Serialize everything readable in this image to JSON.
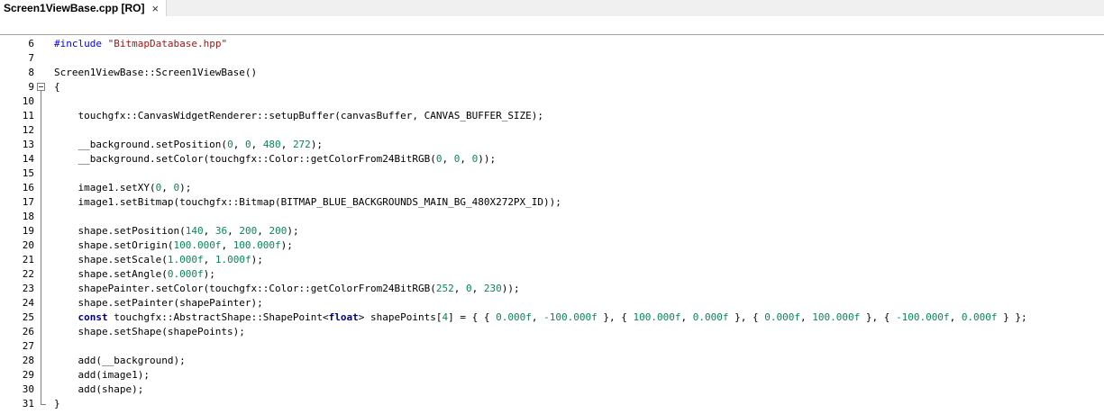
{
  "tab": {
    "label": "Screen1ViewBase.cpp [RO]",
    "close_glyph": "×"
  },
  "editor": {
    "lines": [
      {
        "num": "6",
        "tokens": [
          {
            "t": "#include ",
            "c": "pp"
          },
          {
            "t": "\"BitmapDatabase.hpp\"",
            "c": "str"
          }
        ]
      },
      {
        "num": "7",
        "tokens": []
      },
      {
        "num": "8",
        "tokens": [
          {
            "t": "Screen1ViewBase::Screen1ViewBase()",
            "c": "tok"
          }
        ]
      },
      {
        "num": "9",
        "tokens": [
          {
            "t": "{",
            "c": "tok"
          }
        ]
      },
      {
        "num": "10",
        "tokens": []
      },
      {
        "num": "11",
        "tokens": [
          {
            "t": "    touchgfx::CanvasWidgetRenderer::setupBuffer(canvasBuffer, CANVAS_BUFFER_SIZE);",
            "c": "tok"
          }
        ]
      },
      {
        "num": "12",
        "tokens": []
      },
      {
        "num": "13",
        "tokens": [
          {
            "t": "    __background.setPosition(",
            "c": "tok"
          },
          {
            "t": "0",
            "c": "num"
          },
          {
            "t": ", ",
            "c": "tok"
          },
          {
            "t": "0",
            "c": "num"
          },
          {
            "t": ", ",
            "c": "tok"
          },
          {
            "t": "480",
            "c": "num"
          },
          {
            "t": ", ",
            "c": "tok"
          },
          {
            "t": "272",
            "c": "num"
          },
          {
            "t": ");",
            "c": "tok"
          }
        ]
      },
      {
        "num": "14",
        "tokens": [
          {
            "t": "    __background.setColor(touchgfx::Color::getColorFrom24BitRGB(",
            "c": "tok"
          },
          {
            "t": "0",
            "c": "num"
          },
          {
            "t": ", ",
            "c": "tok"
          },
          {
            "t": "0",
            "c": "num"
          },
          {
            "t": ", ",
            "c": "tok"
          },
          {
            "t": "0",
            "c": "num"
          },
          {
            "t": "));",
            "c": "tok"
          }
        ]
      },
      {
        "num": "15",
        "tokens": []
      },
      {
        "num": "16",
        "tokens": [
          {
            "t": "    image1.setXY(",
            "c": "tok"
          },
          {
            "t": "0",
            "c": "num"
          },
          {
            "t": ", ",
            "c": "tok"
          },
          {
            "t": "0",
            "c": "num"
          },
          {
            "t": ");",
            "c": "tok"
          }
        ]
      },
      {
        "num": "17",
        "tokens": [
          {
            "t": "    image1.setBitmap(touchgfx::Bitmap(BITMAP_BLUE_BACKGROUNDS_MAIN_BG_480X272PX_ID));",
            "c": "tok"
          }
        ]
      },
      {
        "num": "18",
        "tokens": []
      },
      {
        "num": "19",
        "tokens": [
          {
            "t": "    shape.setPosition(",
            "c": "tok"
          },
          {
            "t": "140",
            "c": "num"
          },
          {
            "t": ", ",
            "c": "tok"
          },
          {
            "t": "36",
            "c": "num"
          },
          {
            "t": ", ",
            "c": "tok"
          },
          {
            "t": "200",
            "c": "num"
          },
          {
            "t": ", ",
            "c": "tok"
          },
          {
            "t": "200",
            "c": "num"
          },
          {
            "t": ");",
            "c": "tok"
          }
        ]
      },
      {
        "num": "20",
        "tokens": [
          {
            "t": "    shape.setOrigin(",
            "c": "tok"
          },
          {
            "t": "100.000f",
            "c": "num"
          },
          {
            "t": ", ",
            "c": "tok"
          },
          {
            "t": "100.000f",
            "c": "num"
          },
          {
            "t": ");",
            "c": "tok"
          }
        ]
      },
      {
        "num": "21",
        "tokens": [
          {
            "t": "    shape.setScale(",
            "c": "tok"
          },
          {
            "t": "1.000f",
            "c": "num"
          },
          {
            "t": ", ",
            "c": "tok"
          },
          {
            "t": "1.000f",
            "c": "num"
          },
          {
            "t": ");",
            "c": "tok"
          }
        ]
      },
      {
        "num": "22",
        "tokens": [
          {
            "t": "    shape.setAngle(",
            "c": "tok"
          },
          {
            "t": "0.000f",
            "c": "num"
          },
          {
            "t": ");",
            "c": "tok"
          }
        ]
      },
      {
        "num": "23",
        "tokens": [
          {
            "t": "    shapePainter.setColor(touchgfx::Color::getColorFrom24BitRGB(",
            "c": "tok"
          },
          {
            "t": "252",
            "c": "num"
          },
          {
            "t": ", ",
            "c": "tok"
          },
          {
            "t": "0",
            "c": "num"
          },
          {
            "t": ", ",
            "c": "tok"
          },
          {
            "t": "230",
            "c": "num"
          },
          {
            "t": "));",
            "c": "tok"
          }
        ]
      },
      {
        "num": "24",
        "tokens": [
          {
            "t": "    shape.setPainter(shapePainter);",
            "c": "tok"
          }
        ]
      },
      {
        "num": "25",
        "tokens": [
          {
            "t": "    ",
            "c": "tok"
          },
          {
            "t": "const",
            "c": "bold"
          },
          {
            "t": " touchgfx::AbstractShape::ShapePoint<",
            "c": "tok"
          },
          {
            "t": "float",
            "c": "bold"
          },
          {
            "t": "> shapePoints[",
            "c": "tok"
          },
          {
            "t": "4",
            "c": "num"
          },
          {
            "t": "] = { { ",
            "c": "tok"
          },
          {
            "t": "0.000f",
            "c": "num"
          },
          {
            "t": ", ",
            "c": "tok"
          },
          {
            "t": "-100.000f",
            "c": "num"
          },
          {
            "t": " }, { ",
            "c": "tok"
          },
          {
            "t": "100.000f",
            "c": "num"
          },
          {
            "t": ", ",
            "c": "tok"
          },
          {
            "t": "0.000f",
            "c": "num"
          },
          {
            "t": " }, { ",
            "c": "tok"
          },
          {
            "t": "0.000f",
            "c": "num"
          },
          {
            "t": ", ",
            "c": "tok"
          },
          {
            "t": "100.000f",
            "c": "num"
          },
          {
            "t": " }, { ",
            "c": "tok"
          },
          {
            "t": "-100.000f",
            "c": "num"
          },
          {
            "t": ", ",
            "c": "tok"
          },
          {
            "t": "0.000f",
            "c": "num"
          },
          {
            "t": " } };",
            "c": "tok"
          }
        ]
      },
      {
        "num": "26",
        "tokens": [
          {
            "t": "    shape.setShape(shapePoints);",
            "c": "tok"
          }
        ]
      },
      {
        "num": "27",
        "tokens": []
      },
      {
        "num": "28",
        "tokens": [
          {
            "t": "    add(__background);",
            "c": "tok"
          }
        ]
      },
      {
        "num": "29",
        "tokens": [
          {
            "t": "    add(image1);",
            "c": "tok"
          }
        ]
      },
      {
        "num": "30",
        "tokens": [
          {
            "t": "    add(shape);",
            "c": "tok"
          }
        ]
      },
      {
        "num": "31",
        "tokens": [
          {
            "t": "}",
            "c": "tok"
          }
        ]
      }
    ]
  },
  "colors": {
    "keyword": "#0000ff",
    "string": "#a31515",
    "number": "#098658",
    "type_keyword": "#000080"
  }
}
